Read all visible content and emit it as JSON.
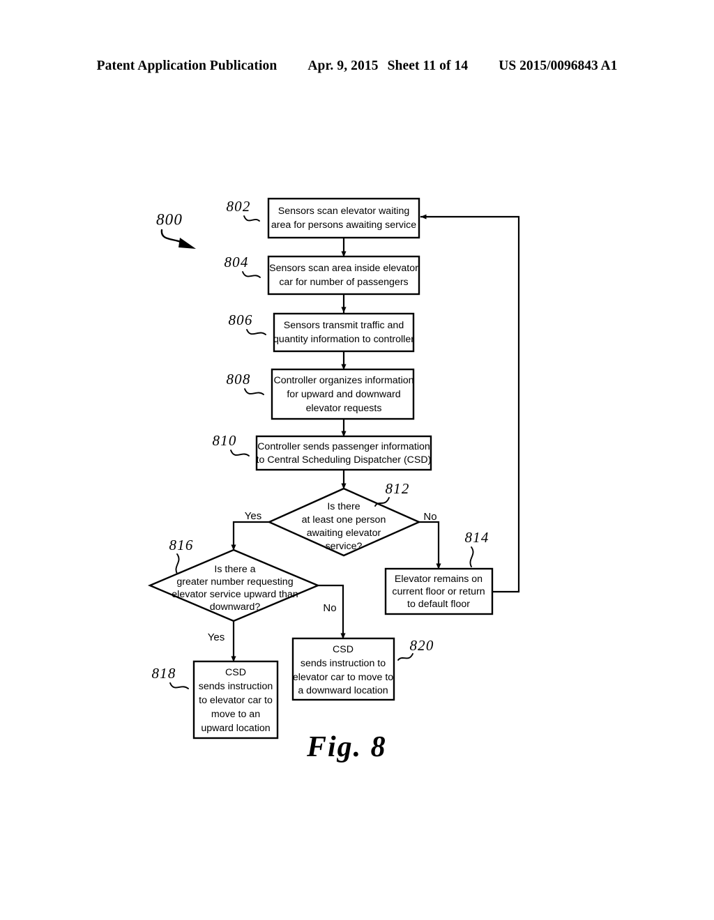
{
  "header": {
    "publication": "Patent Application Publication",
    "date": "Apr. 9, 2015",
    "sheet": "Sheet 11 of 14",
    "patent_number": "US 2015/0096843 A1"
  },
  "figure": {
    "caption": "Fig.  8",
    "diagram_ref": "800"
  },
  "flowchart": {
    "nodes": [
      {
        "ref": "802",
        "shape": "process",
        "lines": [
          "Sensors scan elevator waiting",
          "area for persons awaiting service"
        ]
      },
      {
        "ref": "804",
        "shape": "process",
        "lines": [
          "Sensors scan area inside elevator",
          "car for number of passengers"
        ]
      },
      {
        "ref": "806",
        "shape": "process",
        "lines": [
          "Sensors transmit traffic and",
          "quantity information to controller"
        ]
      },
      {
        "ref": "808",
        "shape": "process",
        "lines": [
          "Controller organizes information",
          "for upward and downward",
          "elevator requests"
        ]
      },
      {
        "ref": "810",
        "shape": "process",
        "lines": [
          "Controller sends passenger information",
          "to Central Scheduling Dispatcher (CSD)"
        ]
      },
      {
        "ref": "812",
        "shape": "decision",
        "lines": [
          "Is there",
          "at least one person",
          "awaiting elevator",
          "service?"
        ]
      },
      {
        "ref": "814",
        "shape": "process",
        "lines": [
          "Elevator remains on",
          "current floor or return",
          "to default floor"
        ]
      },
      {
        "ref": "816",
        "shape": "decision",
        "lines": [
          "Is there a",
          "greater number requesting",
          "elevator service upward than",
          "downward?"
        ]
      },
      {
        "ref": "818",
        "shape": "process",
        "lines": [
          "CSD",
          "sends instruction",
          "to elevator car to",
          "move to an",
          "upward location"
        ]
      },
      {
        "ref": "820",
        "shape": "process",
        "lines": [
          "CSD",
          "sends instruction to",
          "elevator car to move to",
          "a downward location"
        ]
      }
    ],
    "edge_labels": {
      "d812_yes": "Yes",
      "d812_no": "No",
      "d816_yes": "Yes",
      "d816_no": "No"
    }
  }
}
